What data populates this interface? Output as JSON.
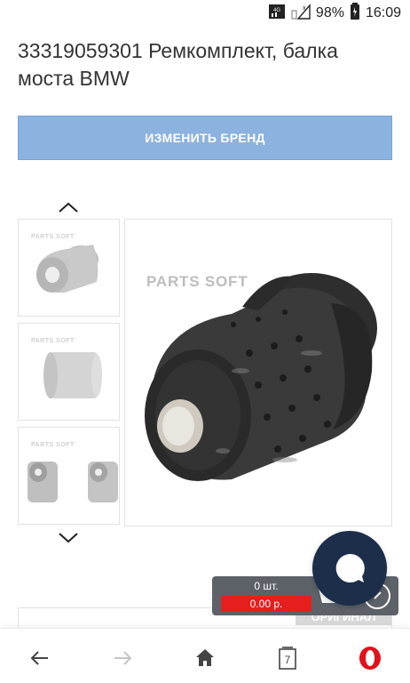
{
  "status_bar": {
    "network": "4G",
    "battery": "98%",
    "time": "16:09"
  },
  "product": {
    "title": "33319059301 Ремкомплект, балка моста BMW",
    "change_brand_label": "ИЗМЕНИТЬ БРЕНД",
    "watermark": "PARTS SOFT",
    "badge": "ОРИГИНАЛ"
  },
  "cart": {
    "quantity": "0 шт.",
    "total": "0.00 р."
  },
  "browser_nav": {
    "tabs_count": "7"
  },
  "colors": {
    "brand_button": "#8cb2df",
    "cart_total": "#e61e1e",
    "chat_bubble": "#1c2e4a",
    "opera_red": "#e2121a"
  }
}
